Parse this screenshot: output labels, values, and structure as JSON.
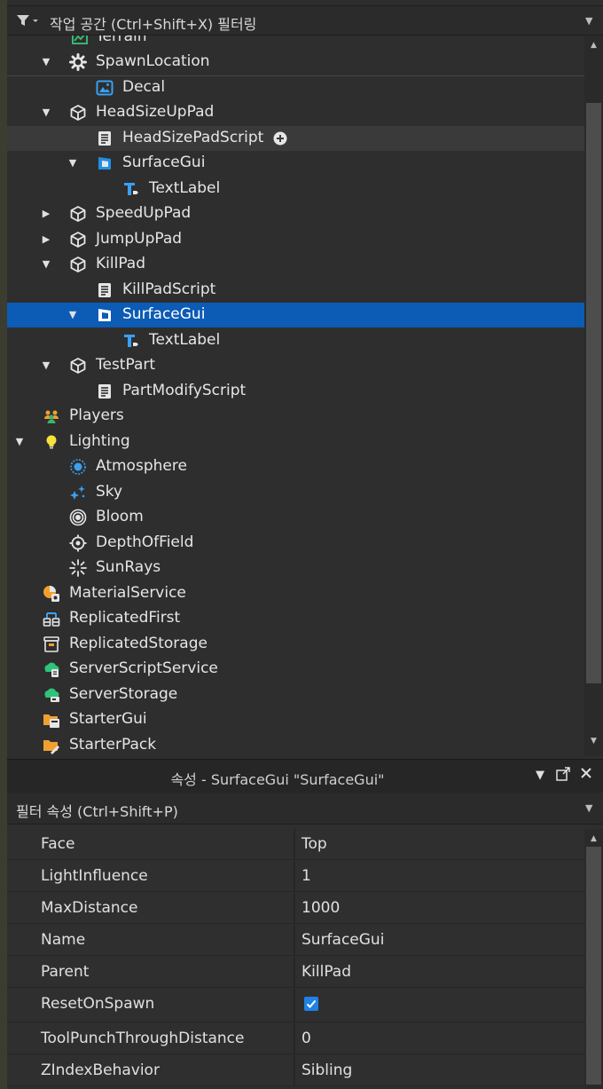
{
  "explorer": {
    "filter_placeholder": "작업 공간 (Ctrl+Shift+X) 필터링",
    "rows": [
      {
        "label": "Terrain",
        "icon": "terrain-icon",
        "state": "normal"
      },
      {
        "label": "SpawnLocation",
        "icon": "gear-icon",
        "state": "normal"
      },
      {
        "label": "Decal",
        "icon": "image-icon",
        "state": "normal"
      },
      {
        "label": "HeadSizeUpPad",
        "icon": "part-cube-icon",
        "state": "normal"
      },
      {
        "label": "HeadSizePadScript",
        "icon": "script-icon",
        "state": "hover"
      },
      {
        "label": "SurfaceGui",
        "icon": "surface-gui-icon",
        "state": "normal"
      },
      {
        "label": "TextLabel",
        "icon": "text-label-icon",
        "state": "normal"
      },
      {
        "label": "SpeedUpPad",
        "icon": "part-cube-icon",
        "state": "normal"
      },
      {
        "label": "JumpUpPad",
        "icon": "part-cube-icon",
        "state": "normal"
      },
      {
        "label": "KillPad",
        "icon": "part-cube-icon",
        "state": "normal"
      },
      {
        "label": "KillPadScript",
        "icon": "script-icon",
        "state": "normal"
      },
      {
        "label": "SurfaceGui",
        "icon": "surface-gui-icon",
        "state": "selected"
      },
      {
        "label": "TextLabel",
        "icon": "text-label-icon",
        "state": "normal"
      },
      {
        "label": "TestPart",
        "icon": "part-cube-icon",
        "state": "normal"
      },
      {
        "label": "PartModifyScript",
        "icon": "script-icon",
        "state": "normal"
      },
      {
        "label": "Players",
        "icon": "players-icon",
        "state": "normal"
      },
      {
        "label": "Lighting",
        "icon": "lightbulb-icon",
        "state": "normal"
      },
      {
        "label": "Atmosphere",
        "icon": "atmosphere-icon",
        "state": "normal"
      },
      {
        "label": "Sky",
        "icon": "sky-stars-icon",
        "state": "normal"
      },
      {
        "label": "Bloom",
        "icon": "bloom-icon",
        "state": "normal"
      },
      {
        "label": "DepthOfField",
        "icon": "depth-of-field-icon",
        "state": "normal"
      },
      {
        "label": "SunRays",
        "icon": "sunrays-icon",
        "state": "normal"
      },
      {
        "label": "MaterialService",
        "icon": "material-service-icon",
        "state": "normal"
      },
      {
        "label": "ReplicatedFirst",
        "icon": "replicated-first-icon",
        "state": "normal"
      },
      {
        "label": "ReplicatedStorage",
        "icon": "replicated-storage-icon",
        "state": "normal"
      },
      {
        "label": "ServerScriptService",
        "icon": "server-script-service-icon",
        "state": "normal"
      },
      {
        "label": "ServerStorage",
        "icon": "server-storage-icon",
        "state": "normal"
      },
      {
        "label": "StarterGui",
        "icon": "starter-gui-icon",
        "state": "normal"
      },
      {
        "label": "StarterPack",
        "icon": "starter-pack-icon",
        "state": "normal"
      }
    ]
  },
  "properties": {
    "title": "속성 - SurfaceGui \"SurfaceGui\"",
    "filter_placeholder": "필터 속성 (Ctrl+Shift+P)",
    "rows": [
      {
        "name": "Face",
        "value": "Top"
      },
      {
        "name": "LightInfluence",
        "value": "1"
      },
      {
        "name": "MaxDistance",
        "value": "1000"
      },
      {
        "name": "Name",
        "value": "SurfaceGui"
      },
      {
        "name": "Parent",
        "value": "KillPad"
      },
      {
        "name": "ResetOnSpawn",
        "value": "",
        "checked": true
      },
      {
        "name": "ToolPunchThroughDistance",
        "value": "0"
      },
      {
        "name": "ZIndexBehavior",
        "value": "Sibling"
      }
    ]
  },
  "colors": {
    "selection": "#0c5bb5",
    "hover": "#3a3a3a",
    "checkbox": "#1e82e6"
  }
}
